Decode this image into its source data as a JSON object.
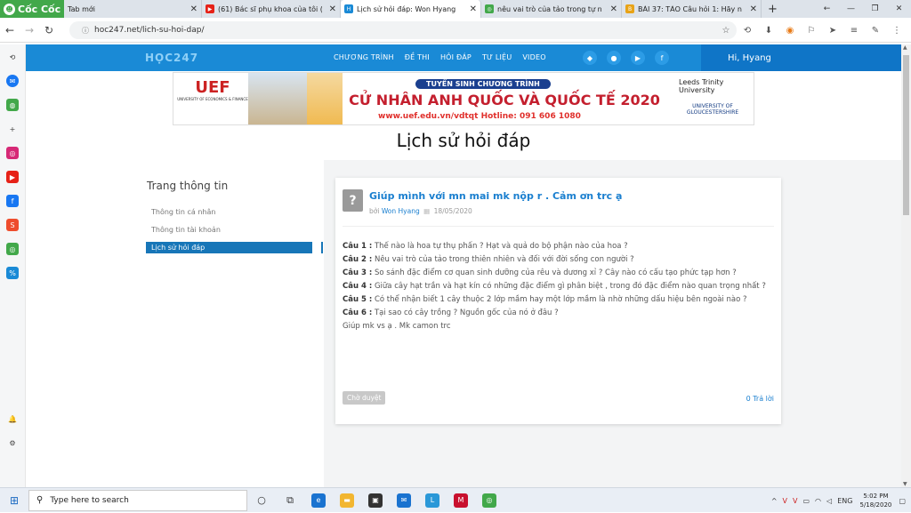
{
  "browser": {
    "brand": "Cốc Cốc",
    "tabs": [
      {
        "title": "Tab mới",
        "fav_color": "#dde3ea"
      },
      {
        "title": "(61) Bác sĩ phụ khoa của tôi (",
        "fav_color": "#e62117"
      },
      {
        "title": "Lịch sử hỏi đáp: Won Hyang",
        "fav_color": "#1a8ad6"
      },
      {
        "title": "nêu vai trò của tảo trong tự n",
        "fav_color": "#42a84a"
      },
      {
        "title": "BÀI 37: TẢO Câu hỏi 1: Hãy n",
        "fav_color": "#e8a317"
      }
    ],
    "url": "hoc247.net/lich-su-hoi-dap/"
  },
  "site": {
    "logo": "HỌC247",
    "menu": [
      "CHƯƠNG TRÌNH",
      "ĐỀ THI",
      "HỎI ĐÁP",
      "TƯ LIỆU",
      "VIDEO"
    ],
    "user": "Hi, Hyang"
  },
  "banner": {
    "uef": "UEF",
    "uef_sub": "UNIVERSITY OF ECONOMICS & FINANCE",
    "pill": "TUYỂN SINH CHƯƠNG TRÌNH",
    "headline": "CỬ NHÂN ANH QUỐC VÀ QUỐC TẾ 2020",
    "contact": "www.uef.edu.vn/vdtqt     Hotline: 091 606 1080",
    "leeds": "Leeds Trinity University",
    "glos": "UNIVERSITY OF GLOUCESTERSHIRE"
  },
  "page_title": "Lịch sử hỏi đáp",
  "left": {
    "title": "Trang thông tin",
    "links": [
      "Thông tin cá nhân",
      "Thông tin tài khoản",
      "Lịch sử hỏi đáp"
    ]
  },
  "question": {
    "title": "Giúp mình với mn mai mk nộp r . Cảm ơn trc ạ",
    "by": "bởi",
    "author": "Won Hyang",
    "date": "18/05/2020",
    "lines": [
      {
        "label": "Câu 1 :",
        "text": " Thế nào là hoa tự thụ phấn ? Hạt và quả do bộ phận nào của hoa ?"
      },
      {
        "label": "Câu 2 :",
        "text": " Nêu vai trò của tảo trong thiên nhiên và đối với đời sống con người ?"
      },
      {
        "label": "Câu 3 :",
        "text": " So sánh đặc điểm cơ quan sinh dưỡng của rêu và dương xỉ ? Cây nào có cấu tạo phức tạp hơn ?"
      },
      {
        "label": "Câu 4 :",
        "text": " Giữa cây hạt trần và hạt kín có những đặc điểm gì phân biệt , trong đó đặc điểm nào quan trọng nhất ?"
      },
      {
        "label": "Câu 5 :",
        "text": " Có thể nhận biết 1 cây thuộc 2 lớp mầm hay một lớp mầm là nhờ những dấu hiệu bên ngoài nào ?"
      },
      {
        "label": "Câu 6 :",
        "text": " Tại sao có cây trồng ? Nguồn gốc của nó ở đâu ?"
      },
      {
        "label": "",
        "text": "Giúp mk vs ạ . Mk camon trc"
      }
    ],
    "status": "Chờ duyệt",
    "answers": "0 Trả lời"
  },
  "taskbar": {
    "search_placeholder": "Type here to search",
    "lang": "ENG",
    "time": "5:02 PM",
    "date": "5/18/2020"
  }
}
